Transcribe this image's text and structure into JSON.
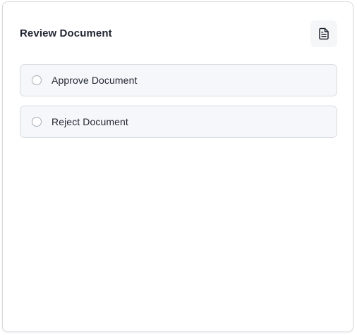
{
  "card": {
    "title": "Review Document",
    "header_icon": "document-icon"
  },
  "options": [
    {
      "label": "Approve Document",
      "selected": false
    },
    {
      "label": "Reject Document",
      "selected": false
    }
  ],
  "colors": {
    "text": "#1f2430",
    "border": "#d8dbe2",
    "option_background": "#f6f7fa",
    "icon_button_background": "#f5f6f8",
    "radio_border": "#a9adb6"
  }
}
